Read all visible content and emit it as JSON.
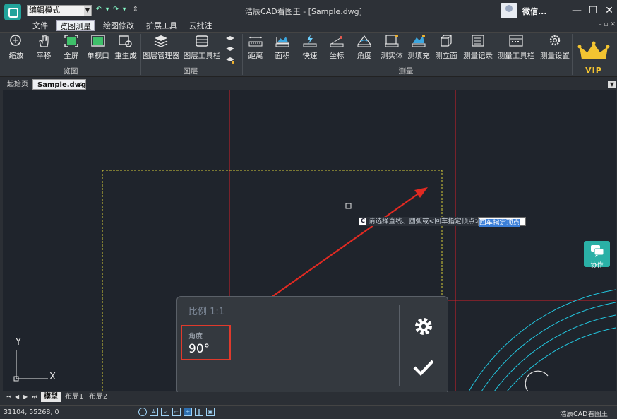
{
  "titlebar": {
    "mode": "编辑模式",
    "title": "浩辰CAD看图王 - [Sample.dwg]",
    "user_name": "微信...",
    "minimize": "—",
    "maximize": "☐",
    "close": "✕"
  },
  "menu": {
    "items": [
      "文件",
      "览图测量",
      "绘图修改",
      "扩展工具",
      "云批注"
    ],
    "active": "览图测量",
    "mini_controls": "– ▫ ✕"
  },
  "ribbon": {
    "groups": {
      "view": {
        "label": "览图",
        "buttons": [
          {
            "label": "缩放",
            "icon": "zoom-icon"
          },
          {
            "label": "平移",
            "icon": "pan-hand-icon"
          },
          {
            "label": "全屏",
            "icon": "fullscreen-icon"
          },
          {
            "label": "单视口",
            "icon": "single-viewport-icon"
          },
          {
            "label": "重生成",
            "icon": "regenerate-icon"
          }
        ]
      },
      "layer": {
        "label": "图层",
        "buttons": [
          {
            "label": "图层管理器",
            "icon": "layer-manager-icon"
          },
          {
            "label": "图层工具栏",
            "icon": "layer-toolbar-icon"
          }
        ]
      },
      "measure": {
        "label": "测量",
        "buttons": [
          {
            "label": "距离",
            "icon": "distance-icon"
          },
          {
            "label": "面积",
            "icon": "area-icon"
          },
          {
            "label": "快速",
            "icon": "quick-measure-icon"
          },
          {
            "label": "坐标",
            "icon": "coordinate-icon"
          },
          {
            "label": "角度",
            "icon": "angle-icon"
          },
          {
            "label": "测实体",
            "icon": "measure-entity-icon"
          },
          {
            "label": "测填充",
            "icon": "measure-hatch-icon"
          },
          {
            "label": "测立面",
            "icon": "measure-elevation-icon"
          },
          {
            "label": "测量记录",
            "icon": "measure-record-icon"
          },
          {
            "label": "测量工具栏",
            "icon": "measure-toolbar-icon"
          },
          {
            "label": "测量设置",
            "icon": "measure-settings-icon"
          }
        ]
      }
    },
    "vip": "VIP"
  },
  "doc_tabs": [
    "起始页",
    "Sample.dwg"
  ],
  "doc_tab_close": "✕",
  "canvas": {
    "command_prompt": "请选择直线、圆弧或<回车指定顶点>:",
    "command_input": "回车指定顶点",
    "collab_label": "协作",
    "axis_y": "Y",
    "axis_x": "X"
  },
  "measure_panel": {
    "scale": "比例 1:1",
    "angle_label": "角度",
    "angle_value": "90°"
  },
  "layout_tabs": [
    "模型",
    "布局1",
    "布局2"
  ],
  "status": {
    "coords": "31104, 55268, 0",
    "brand": "浩辰CAD看图王"
  },
  "colors": {
    "accent": "#22a39b",
    "highlight_box": "#e03a2c",
    "canvas_bg": "#1f242c"
  }
}
